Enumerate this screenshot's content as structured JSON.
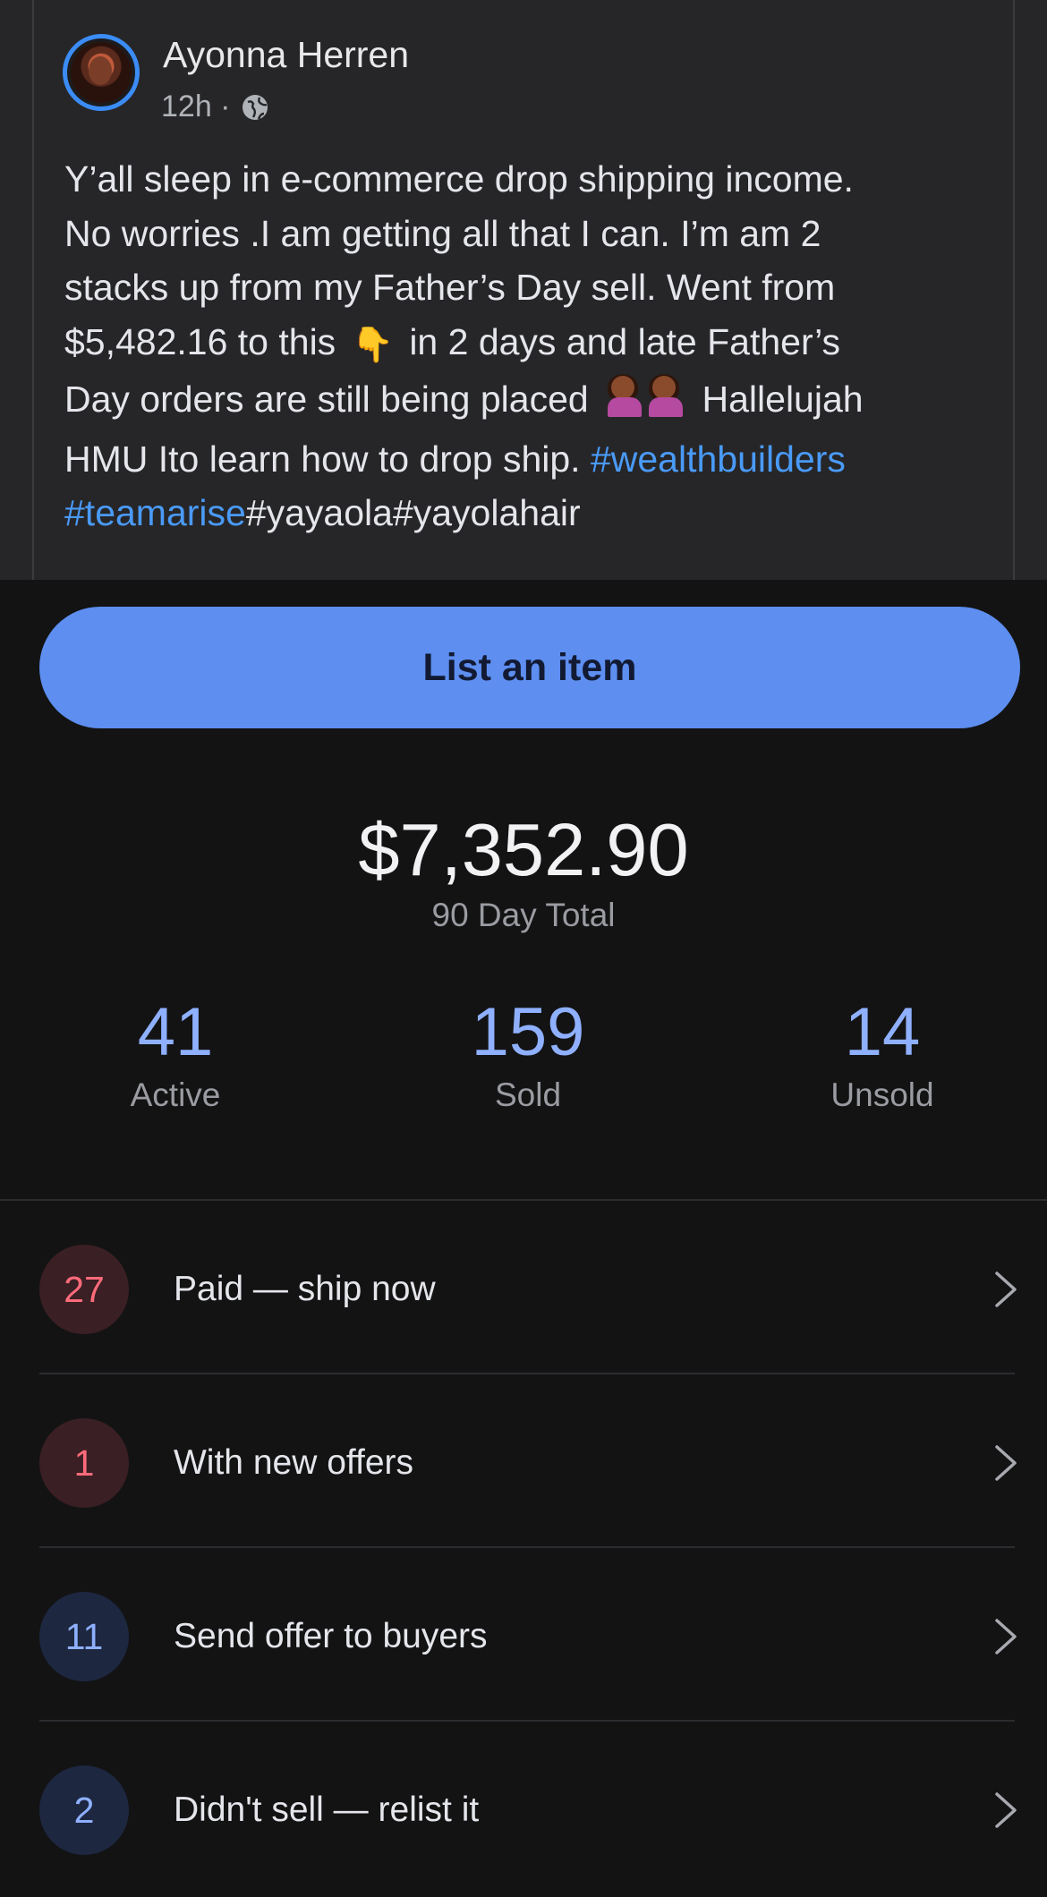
{
  "post": {
    "author": "Ayonna Herren",
    "time": "12h ·",
    "privacy_icon": "globe-icon",
    "body_lines": [
      "Y’all sleep in e-commerce drop shipping income.",
      "No worries .I am getting all that I can. I’m am 2",
      "stacks up from my Father’s Day sell. Went from"
    ],
    "line4_before": "$5,482.16 to this",
    "line4_emoji": "👇",
    "line4_after": "in 2 days and late Father’s",
    "line5_before": "Day orders are still being placed",
    "line5_after": "Hallelujah",
    "line6_text": "HMU Ito learn how to drop ship.",
    "hashtag_wealth": "#wealthbuilders",
    "hashtag_arise": "#teamarise",
    "hashtag_rest": "#yayaola#yayolahair",
    "hashtag_color": "#4a9af7"
  },
  "selling": {
    "list_button": "List an item",
    "total_amount": "$7,352.90",
    "total_label": "90 Day Total",
    "stats": [
      {
        "value": "41",
        "label": "Active"
      },
      {
        "value": "159",
        "label": "Sold"
      },
      {
        "value": "14",
        "label": "Unsold"
      }
    ],
    "tasks": [
      {
        "count": "27",
        "label": "Paid — ship now"
      },
      {
        "count": "1",
        "label": "With new offers"
      },
      {
        "count": "11",
        "label": "Send offer to buyers"
      },
      {
        "count": "2",
        "label": "Didn't sell — relist it"
      }
    ],
    "accent_color": "#5d8ef0"
  }
}
